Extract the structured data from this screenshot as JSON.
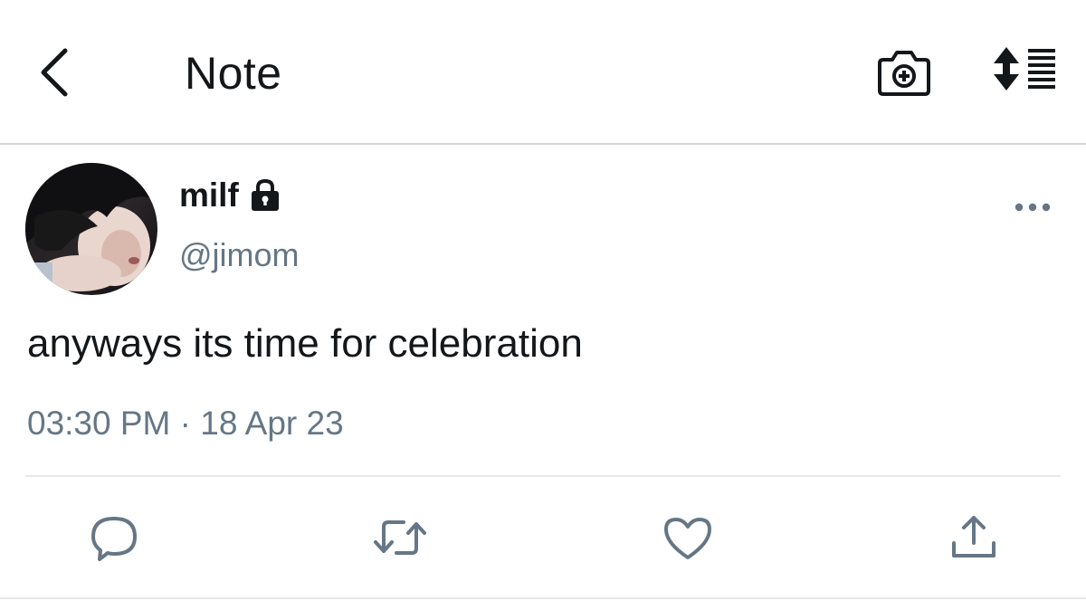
{
  "header": {
    "title": "Note",
    "back_icon": "chevron-left-icon",
    "camera_icon": "camera-add-icon",
    "sort_icon": "sort-list-icon"
  },
  "tweet": {
    "display_name": "milf",
    "handle": "@jimom",
    "protected_icon": "lock-icon",
    "text": "anyways its time for celebration",
    "time": "03:30 PM",
    "separator": "·",
    "date": "18 Apr 23",
    "more_icon": "ellipsis-icon"
  },
  "actions": [
    {
      "name": "reply",
      "icon": "reply-icon"
    },
    {
      "name": "retweet",
      "icon": "retweet-icon"
    },
    {
      "name": "like",
      "icon": "heart-icon"
    },
    {
      "name": "share",
      "icon": "share-icon"
    }
  ],
  "colors": {
    "primary_text": "#14171a",
    "secondary_text": "#657786",
    "icon_gray": "#657786",
    "divider": "#e6e8ea",
    "header_border": "#d4d6d8"
  }
}
